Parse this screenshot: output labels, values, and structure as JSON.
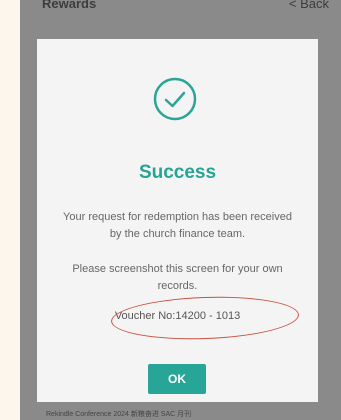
{
  "header": {
    "title": "Rewards",
    "back_label": "< Back"
  },
  "modal": {
    "icon": "check-circle-icon",
    "heading": "Success",
    "message": "Your request for redemption has been received by the church finance team.",
    "instruction": "Please screenshot this screen for your own records.",
    "voucher": "Voucher No:14200 - 1013",
    "ok_label": "OK",
    "accent_color": "#27a597"
  },
  "footer": {
    "text": "Rekindle Conference 2024 新粮奋进 SAC 月刊"
  },
  "annotation": {
    "color": "#c8503f"
  }
}
